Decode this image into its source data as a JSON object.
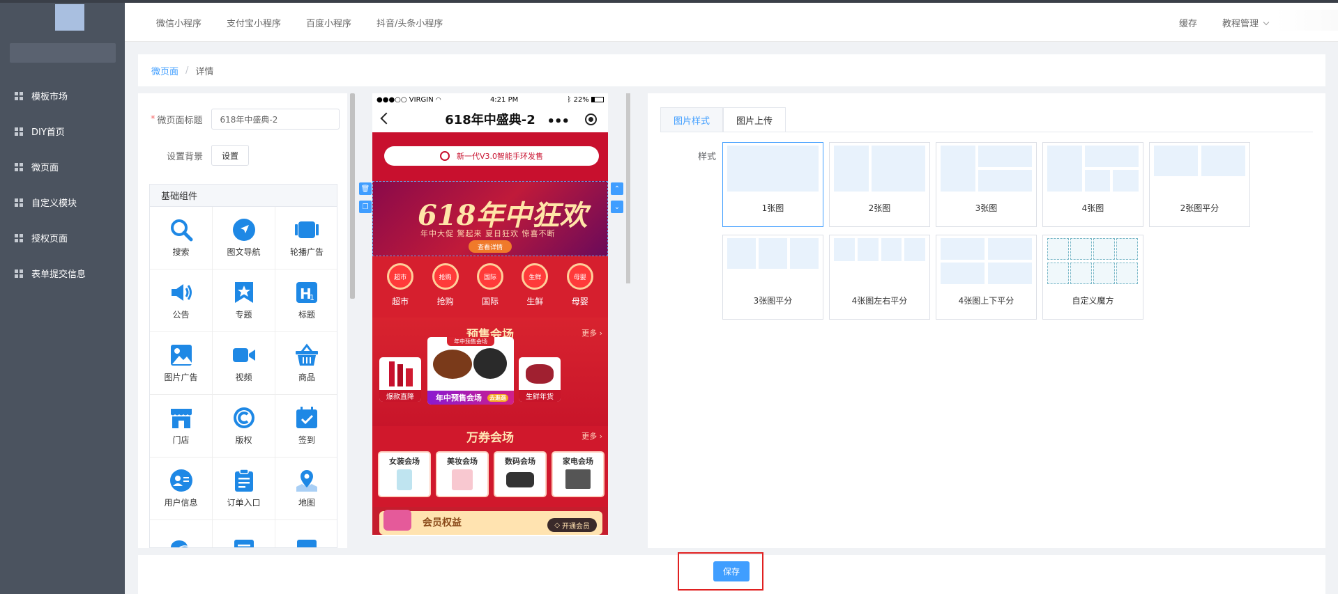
{
  "header": {
    "tabs": [
      "微信小程序",
      "支付宝小程序",
      "百度小程序",
      "抖音/头条小程序"
    ],
    "cache_label": "缓存",
    "tutorial_label": "教程管理"
  },
  "sidebar": {
    "items": [
      {
        "label": "模板市场"
      },
      {
        "label": "DIY首页"
      },
      {
        "label": "微页面"
      },
      {
        "label": "自定义模块"
      },
      {
        "label": "授权页面"
      },
      {
        "label": "表单提交信息"
      }
    ]
  },
  "breadcrumb": {
    "parent": "微页面",
    "separator": "/",
    "current": "详情"
  },
  "form": {
    "title_label": "微页面标题",
    "title_value": "618年中盛典-2",
    "background_label": "设置背景",
    "background_button": "设置"
  },
  "components": {
    "section_title": "基础组件",
    "items": [
      {
        "label": "搜索",
        "icon": "search-icon"
      },
      {
        "label": "图文导航",
        "icon": "navigation-icon"
      },
      {
        "label": "轮播广告",
        "icon": "carousel-icon"
      },
      {
        "label": "公告",
        "icon": "megaphone-icon"
      },
      {
        "label": "专题",
        "icon": "star-bookmark-icon"
      },
      {
        "label": "标题",
        "icon": "heading-icon"
      },
      {
        "label": "图片广告",
        "icon": "image-icon"
      },
      {
        "label": "视频",
        "icon": "video-icon"
      },
      {
        "label": "商品",
        "icon": "basket-icon"
      },
      {
        "label": "门店",
        "icon": "store-icon"
      },
      {
        "label": "版权",
        "icon": "copyright-icon"
      },
      {
        "label": "签到",
        "icon": "calendar-check-icon"
      },
      {
        "label": "用户信息",
        "icon": "user-icon"
      },
      {
        "label": "订单入口",
        "icon": "clipboard-icon"
      },
      {
        "label": "地图",
        "icon": "map-pin-icon"
      },
      {
        "label": "",
        "icon": "chat-icon"
      },
      {
        "label": "",
        "icon": "list-icon"
      },
      {
        "label": "",
        "icon": "picture-icon"
      }
    ]
  },
  "phone": {
    "carrier": "●●●○○ VIRGIN",
    "time": "4:21 PM",
    "battery": "22%",
    "page_title": "618年中盛典-2",
    "search_text": "新一代V3.0智能手环发售",
    "banner": {
      "title": "618年中狂欢",
      "subtitle": "年中大促 驚起来 夏日狂欢 惊喜不断",
      "button": "查看详情"
    },
    "categories": [
      {
        "badge": "超市",
        "label": "超市"
      },
      {
        "badge": "抢购",
        "label": "抢购"
      },
      {
        "badge": "国际",
        "label": "国际"
      },
      {
        "badge": "生鲜",
        "label": "生鲜"
      },
      {
        "badge": "母婴",
        "label": "母婴"
      }
    ],
    "presale": {
      "title": "预售会场",
      "more": "更多",
      "left_label": "爆款直降",
      "center_tag": "年中预售会场",
      "center_label": "年中预售会场",
      "center_badge": "去逛逛",
      "right_label": "生鲜年货"
    },
    "coupons": {
      "title": "万券会场",
      "more": "更多",
      "items": [
        "女装会场",
        "美妆会场",
        "数码会场",
        "家电会场"
      ]
    },
    "member": {
      "title": "会员权益",
      "button": "开通会员"
    }
  },
  "settings": {
    "tabs": [
      "图片样式",
      "图片上传"
    ],
    "style_label": "样式",
    "options": [
      {
        "label": "1张图"
      },
      {
        "label": "2张图"
      },
      {
        "label": "3张图"
      },
      {
        "label": "4张图"
      },
      {
        "label": "2张图平分"
      },
      {
        "label": "3张图平分"
      },
      {
        "label": "4张图左右平分"
      },
      {
        "label": "4张图上下平分"
      },
      {
        "label": "自定义魔方"
      }
    ]
  },
  "footer": {
    "save_label": "保存"
  },
  "colors": {
    "accent": "#409eff",
    "sidebar": "#4b535f",
    "highlight": "#e02020",
    "promo_red": "#c8102e"
  }
}
